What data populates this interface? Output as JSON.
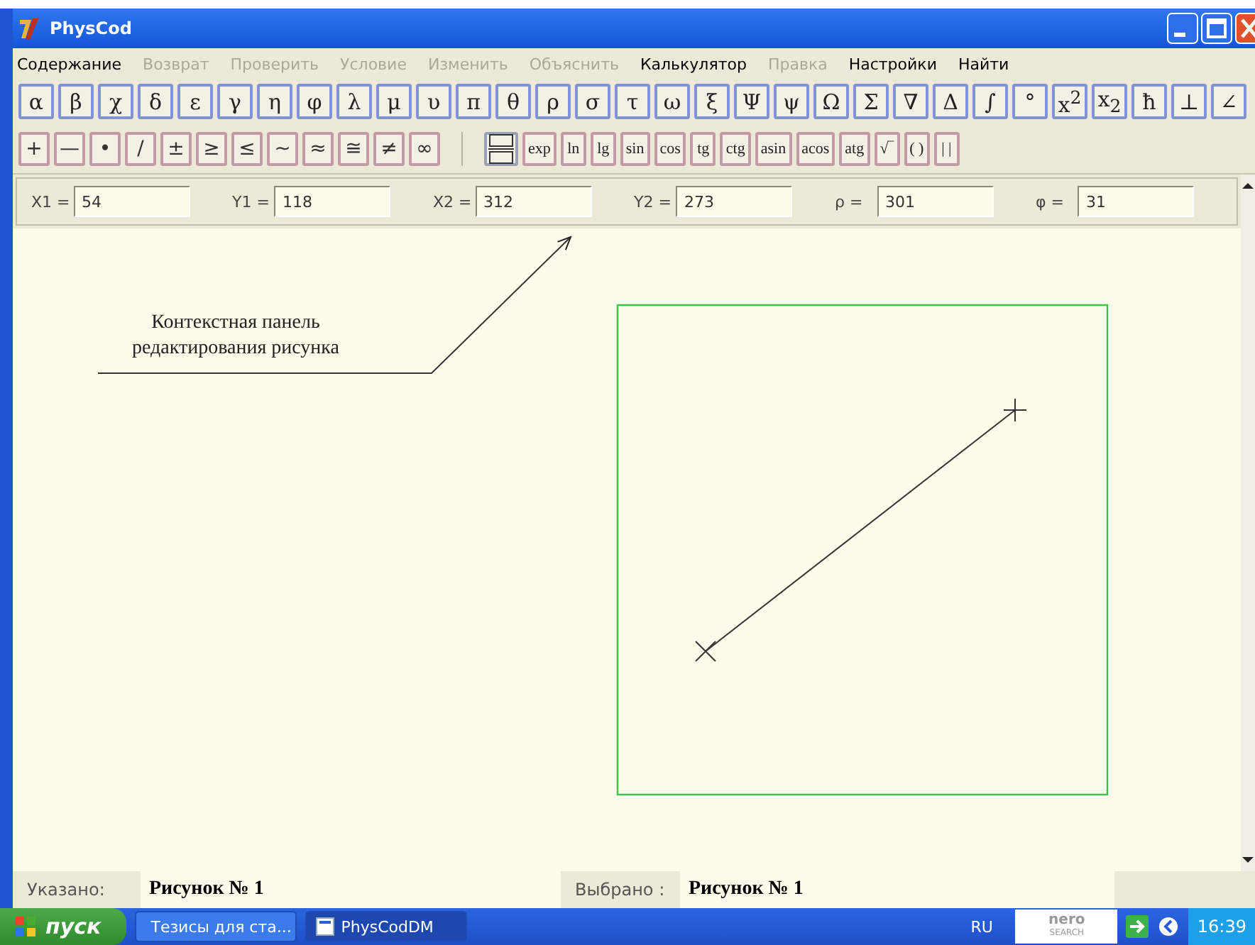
{
  "window": {
    "title": "PhysCod"
  },
  "menu": [
    {
      "label": "Содержание",
      "disabled": false
    },
    {
      "label": "Возврат",
      "disabled": true
    },
    {
      "label": "Проверить",
      "disabled": true
    },
    {
      "label": "Условие",
      "disabled": true
    },
    {
      "label": "Изменить",
      "disabled": true
    },
    {
      "label": "Объяснить",
      "disabled": true
    },
    {
      "label": "Калькулятор",
      "disabled": false
    },
    {
      "label": "Правка",
      "disabled": true
    },
    {
      "label": "Настройки",
      "disabled": false
    },
    {
      "label": "Найти",
      "disabled": false
    }
  ],
  "symbol_toolbar": [
    "α",
    "β",
    "χ",
    "δ",
    "ε",
    "γ",
    "η",
    "φ",
    "λ",
    "μ",
    "υ",
    "π",
    "θ",
    "ρ",
    "σ",
    "τ",
    "ω",
    "ξ",
    "Ψ",
    "ψ",
    "Ω",
    "Σ",
    "∇",
    "Δ",
    "∫",
    "°",
    "x$^{2}$",
    "x$_{2}$",
    "ħ",
    "⊥",
    "∠"
  ],
  "operator_toolbar": [
    "+",
    "—",
    "•",
    "∕",
    "±",
    "≥",
    "≤",
    "~",
    "≈",
    "≅",
    "≠",
    "∞"
  ],
  "function_toolbar": [
    {
      "kind": "icon"
    },
    {
      "kind": "text",
      "label": "exp"
    },
    {
      "kind": "text",
      "label": "ln"
    },
    {
      "kind": "text",
      "label": "lg"
    },
    {
      "kind": "text",
      "label": "sin"
    },
    {
      "kind": "text",
      "label": "cos"
    },
    {
      "kind": "text",
      "label": "tg"
    },
    {
      "kind": "text",
      "label": "ctg"
    },
    {
      "kind": "text",
      "label": "asin"
    },
    {
      "kind": "text",
      "label": "acos"
    },
    {
      "kind": "text",
      "label": "atg"
    },
    {
      "kind": "text",
      "label": "√‾"
    },
    {
      "kind": "text",
      "label": "( )"
    },
    {
      "kind": "text",
      "label": "| |"
    }
  ],
  "coordinates": [
    {
      "label": "X1 =",
      "value": "54"
    },
    {
      "label": "Y1 =",
      "value": "118"
    },
    {
      "label": "X2 =",
      "value": "312"
    },
    {
      "label": "Y2 =",
      "value": "273"
    },
    {
      "label": "ρ =",
      "value": "301"
    },
    {
      "label": "φ =",
      "value": "31"
    }
  ],
  "canvas": {
    "callout": "Контекстная панель редактирования рисунка"
  },
  "status_bar": {
    "pointed_label": "Указано:",
    "pointed_value": "Рисунок № 1",
    "selected_label": "Выбрано :",
    "selected_value": "Рисунок № 1"
  },
  "taskbar": {
    "start": "пуск",
    "tasks": [
      {
        "label": "Тезисы для ста...",
        "selected": false
      },
      {
        "label": "PhysCodDM",
        "selected": true
      }
    ],
    "language": "RU",
    "search_brand": "nero",
    "search_caption": "SEARCH",
    "time": "16:39"
  }
}
